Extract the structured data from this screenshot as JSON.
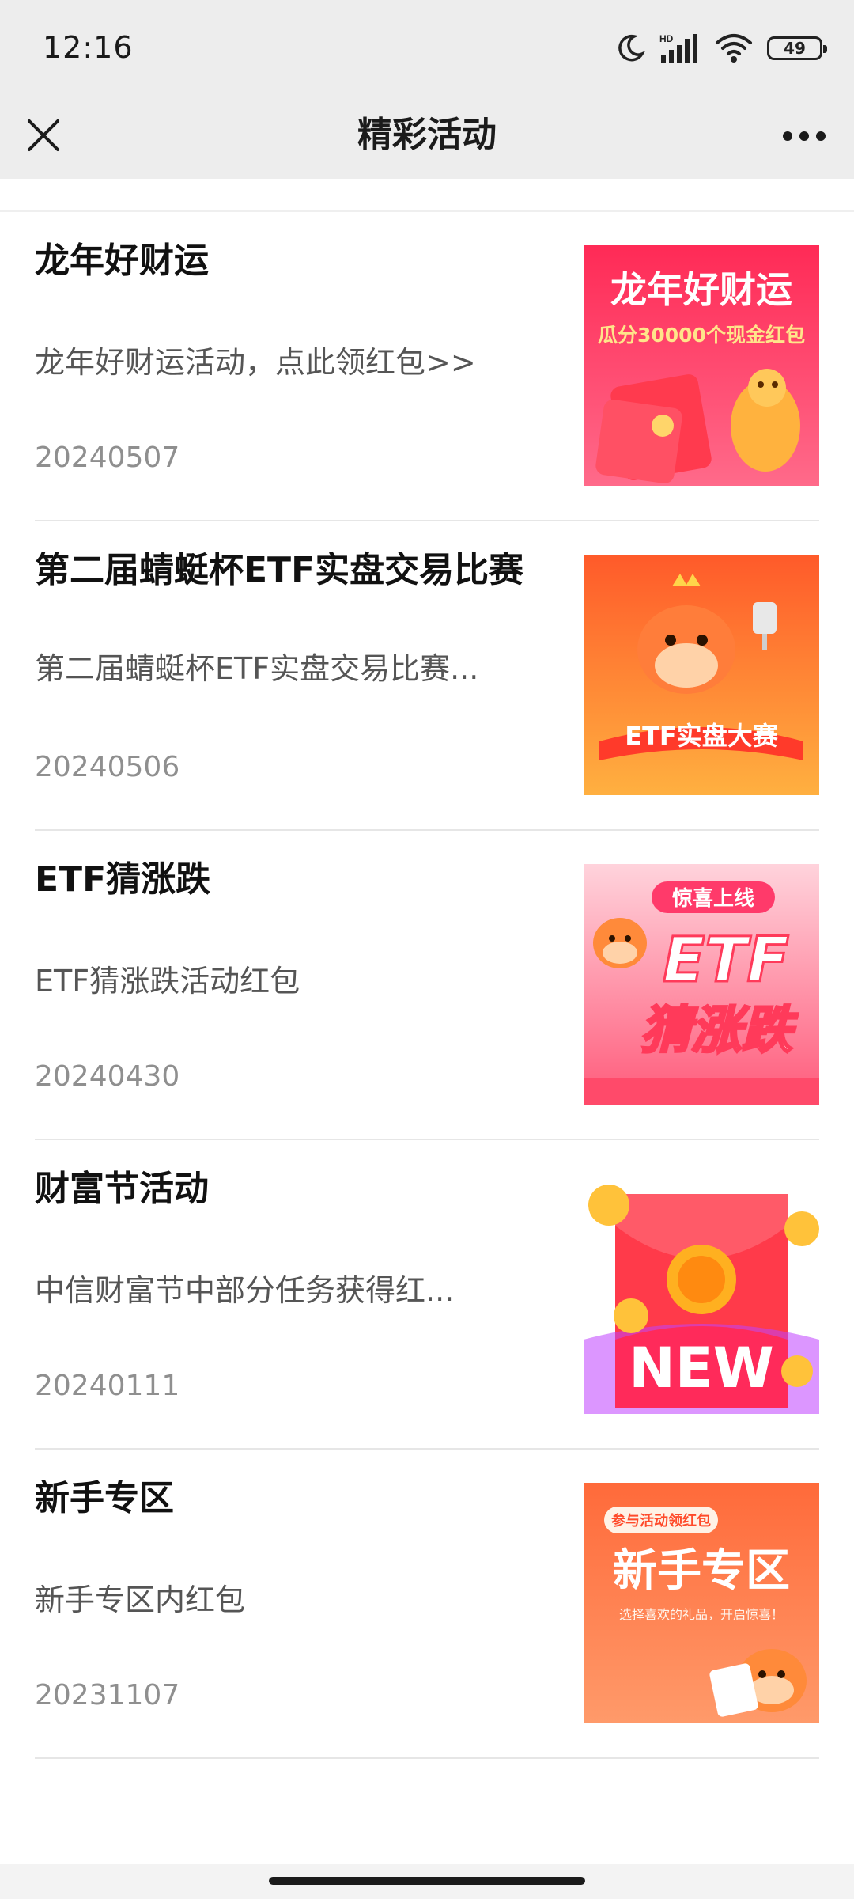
{
  "status_bar": {
    "time": "12:16",
    "battery": "49",
    "network": "HD"
  },
  "nav": {
    "title": "精彩活动"
  },
  "colors": {
    "header_bg": "#ededed",
    "divider": "#e6e6e6",
    "date": "#8f8f8f"
  },
  "items": [
    {
      "title": "龙年好财运",
      "desc": "龙年好财运活动，点此领红包>>",
      "date": "20240507",
      "thumb": {
        "headline": "龙年好财运",
        "sub": "瓜分30000个现金红包",
        "icon": "dragon-red-envelope"
      }
    },
    {
      "title": "第二届蜻蜓杯ETF实盘交易比赛",
      "desc": "第二届蜻蜓杯ETF实盘交易比赛...",
      "date": "20240506",
      "thumb": {
        "banner": "ETF实盘大赛",
        "icon": "cow-trophy"
      }
    },
    {
      "title": "ETF猜涨跌",
      "desc": "ETF猜涨跌活动红包",
      "date": "20240430",
      "thumb": {
        "badge": "惊喜上线",
        "big1": "ETF",
        "big2": "猜涨跌",
        "icon": "cow-mascot"
      }
    },
    {
      "title": "财富节活动",
      "desc": "中信财富节中部分任务获得红...",
      "date": "20240111",
      "thumb": {
        "label": "NEW",
        "icon": "red-envelope-coins"
      }
    },
    {
      "title": "新手专区",
      "desc": "新手专区内红包",
      "date": "20231107",
      "thumb": {
        "pill": "参与活动领红包",
        "headline": "新手专区",
        "sub": "选择喜欢的礼品，开启惊喜！",
        "icon": "cow-calendar"
      }
    }
  ]
}
